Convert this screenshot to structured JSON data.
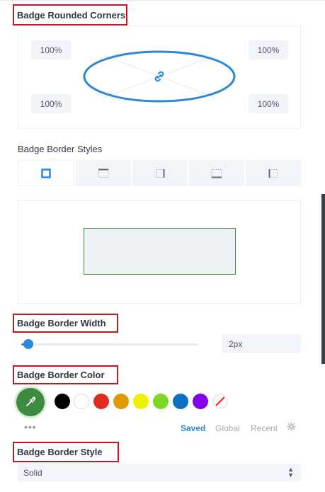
{
  "rounded_corners": {
    "title": "Badge Rounded Corners",
    "top_left": "100%",
    "top_right": "100%",
    "bottom_left": "100%",
    "bottom_right": "100%"
  },
  "border_styles": {
    "title": "Badge Border Styles",
    "tabs": [
      "all-sides-icon",
      "top-side-icon",
      "right-side-icon",
      "bottom-side-icon",
      "left-side-icon"
    ]
  },
  "border_width": {
    "title": "Badge Border Width",
    "value": "2px",
    "slider_fraction": 0.04
  },
  "border_color": {
    "title": "Badge Border Color",
    "selected": "#3e8a3e",
    "swatches": [
      "#000000",
      "#ffffff",
      "#e02b20",
      "#e09900",
      "#edf000",
      "#7cda24",
      "#0c71c3",
      "#8300e9"
    ],
    "more": "•••",
    "tabs": [
      "Saved",
      "Global",
      "Recent"
    ],
    "active_tab_color": "#2b87da"
  },
  "border_style": {
    "title": "Badge Border Style",
    "value": "Solid"
  }
}
